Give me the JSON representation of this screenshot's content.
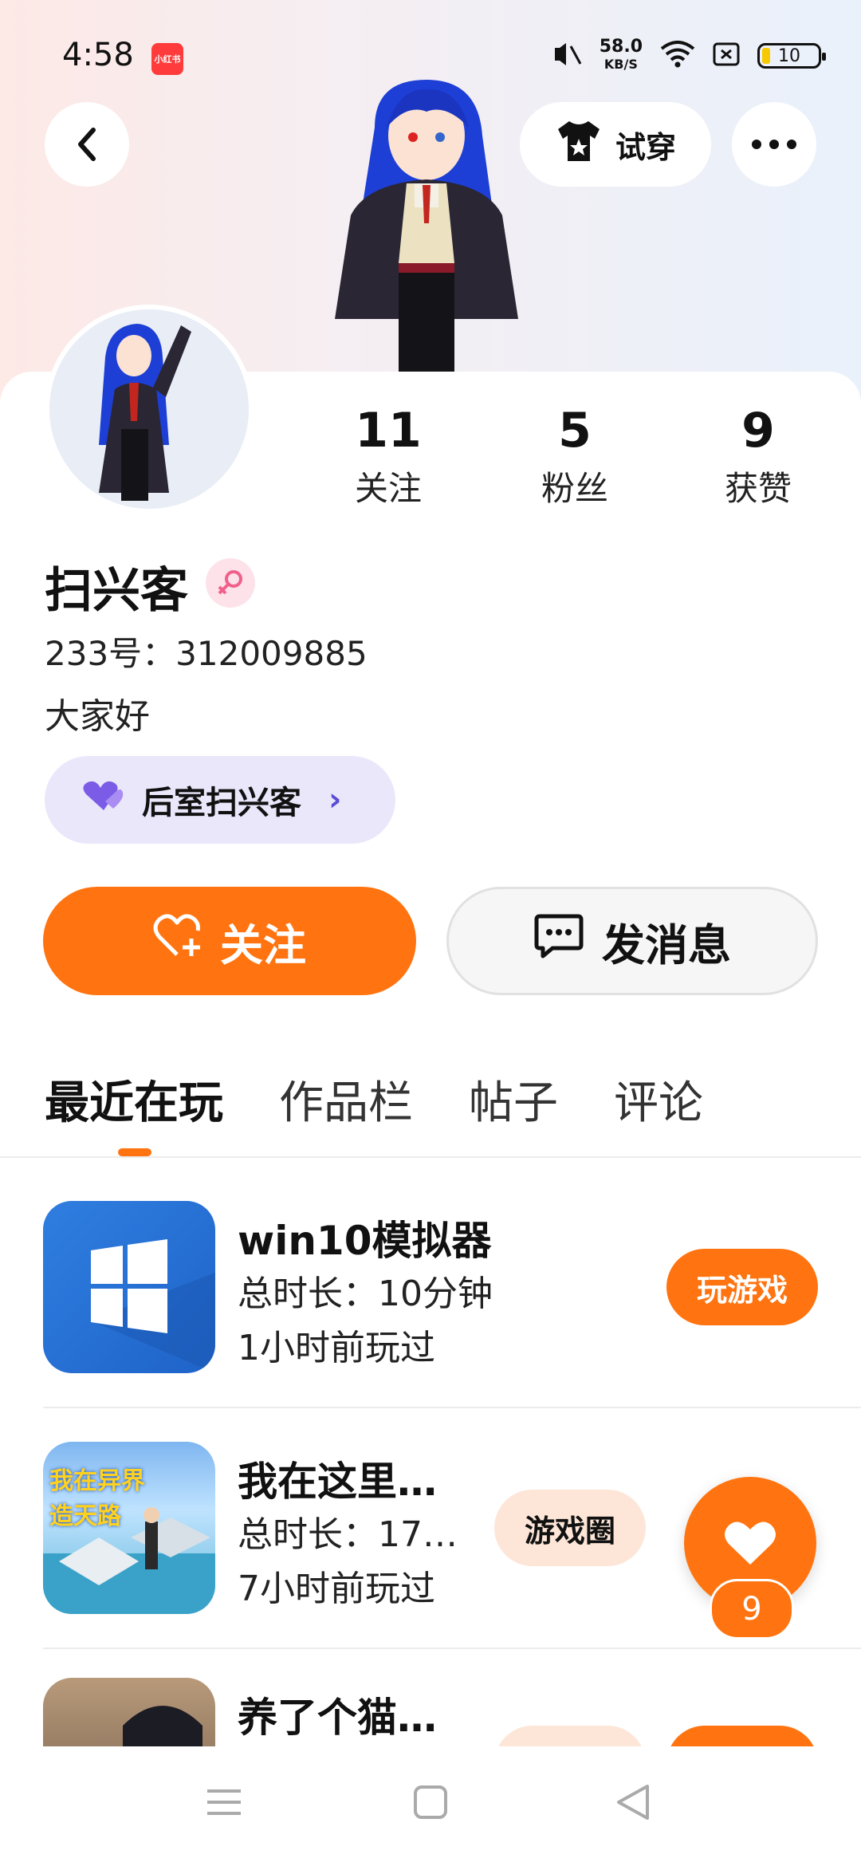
{
  "status_bar": {
    "time": "4:58",
    "app_badge": "小红书",
    "speed_value": "58.0",
    "speed_unit": "KB/S",
    "battery": "10"
  },
  "header": {
    "tryon_label": "试穿"
  },
  "stats": [
    {
      "value": "11",
      "label": "关注"
    },
    {
      "value": "5",
      "label": "粉丝"
    },
    {
      "value": "9",
      "label": "获赞"
    }
  ],
  "profile": {
    "name": "扫兴客",
    "uid": "233号：312009885",
    "bio": "大家好",
    "tag": "后室扫兴客"
  },
  "actions": {
    "follow_label": "关注",
    "message_label": "发消息"
  },
  "tabs": [
    "最近在玩",
    "作品栏",
    "帖子",
    "评论"
  ],
  "games": [
    {
      "title": "win10模拟器",
      "duration": "总时长：10分钟",
      "last_played": "1小时前玩过",
      "button": "玩游戏"
    },
    {
      "title": "我在这里…",
      "thumb_text": "我在异界 造天路",
      "duration": "总时长：17…",
      "last_played": "7小时前玩过",
      "button": "游戏圈"
    },
    {
      "title": "养了个猫…"
    }
  ],
  "like_fab": {
    "count": "9"
  },
  "colors": {
    "accent": "#ff7410",
    "tag_bg": "#ebe7fb",
    "tag_heart": "#7a5ce6"
  }
}
